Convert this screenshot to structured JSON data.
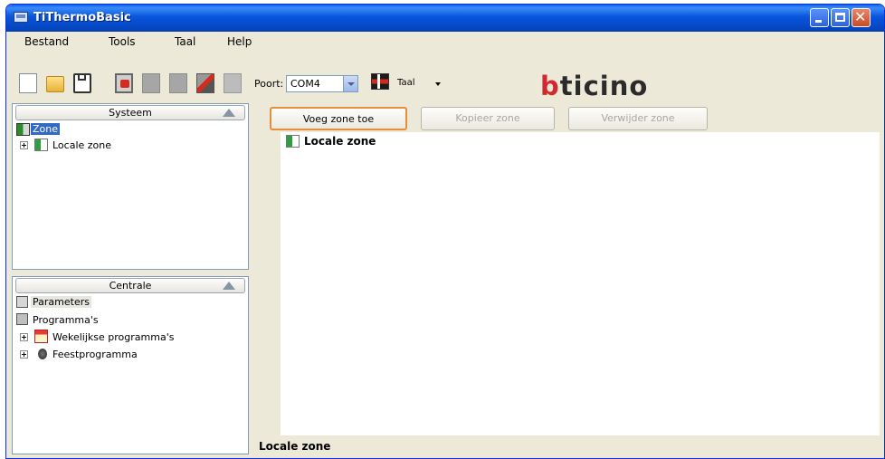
{
  "window": {
    "title": "TiThermoBasic"
  },
  "menu": [
    "Bestand",
    "Tools",
    "Taal",
    "Help"
  ],
  "toolbar": {
    "port_label": "Poort:",
    "port_value": "COM4",
    "language_label": "Taal",
    "logo": {
      "b": "b",
      "rest": "ticino"
    }
  },
  "systeem": {
    "header": "Systeem",
    "tree": [
      {
        "label": "Zone",
        "selected": true
      },
      {
        "label": "Locale zone"
      }
    ]
  },
  "centrale": {
    "header": "Centrale",
    "tree": [
      {
        "label": "Parameters"
      },
      {
        "label": "Programma's"
      },
      {
        "label": "Wekelijkse programma's"
      },
      {
        "label": "Feestprogramma"
      }
    ]
  },
  "actions": {
    "add_zone": "Voeg zone toe",
    "copy_zone": "Kopieer zone",
    "remove_zone": "Verwijder zone"
  },
  "content": {
    "title": "Locale zone"
  },
  "status": {
    "text": "Locale zone"
  },
  "colors": {
    "titlebar": "#0855dd",
    "selection": "#316ac5",
    "focus_border": "#e78e39",
    "brand_red": "#d2282e"
  }
}
